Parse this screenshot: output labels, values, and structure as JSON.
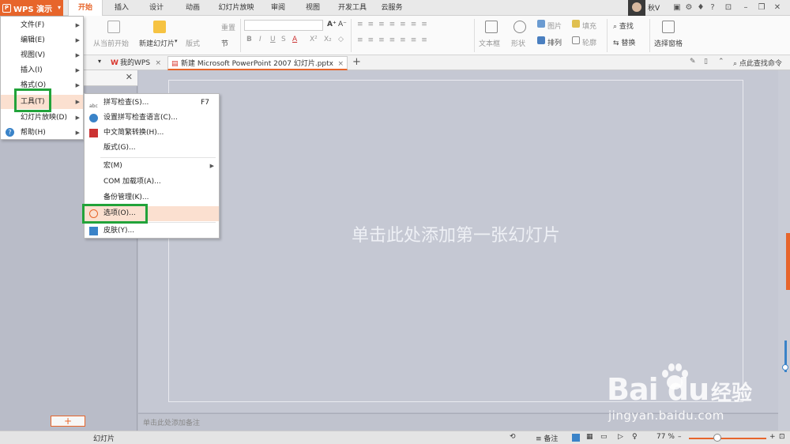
{
  "app": {
    "button_label": "WPS 演示",
    "user_name": "秋V"
  },
  "ribbon_tabs": [
    "开始",
    "插入",
    "设计",
    "动画",
    "幻灯片放映",
    "审阅",
    "视图",
    "开发工具",
    "云服务"
  ],
  "ribbon": {
    "from_current": "从当前开始",
    "new_slide": "新建幻灯片",
    "layout": "版式",
    "reset": "重置",
    "section": "节",
    "textbox": "文本框",
    "shape": "形状",
    "picture": "图片",
    "arrange": "排列",
    "fill": "填充",
    "outline": "轮廓",
    "find": "查找",
    "replace": "替换",
    "selection_pane": "选择窗格",
    "search_cmd": "点此查找命令"
  },
  "doc_tabs": [
    {
      "label": "我的WPS",
      "close": "×"
    },
    {
      "label": "新建 Microsoft PowerPoint 2007 幻灯片.pptx",
      "close": "×"
    }
  ],
  "doc_add": "+",
  "main_menu": {
    "items": [
      {
        "label": "文件(F)"
      },
      {
        "label": "编辑(E)"
      },
      {
        "label": "视图(V)"
      },
      {
        "label": "插入(I)"
      },
      {
        "label": "格式(O)"
      },
      {
        "label": "工具(T)"
      },
      {
        "label": "幻灯片放映(D)"
      },
      {
        "label": "帮助(H)"
      }
    ]
  },
  "tools_menu": {
    "items": [
      {
        "label": "拼写检查(S)...",
        "shortcut": "F7"
      },
      {
        "label": "设置拼写检查语言(C)..."
      },
      {
        "label": "中文简繁转换(H)..."
      },
      {
        "label": "版式(G)..."
      },
      {
        "label": "宏(M)"
      },
      {
        "label": "COM 加载项(A)..."
      },
      {
        "label": "备份管理(K)..."
      },
      {
        "label": "选项(O)..."
      },
      {
        "label": "皮肤(Y)..."
      }
    ]
  },
  "slide": {
    "prompt": "单击此处添加第一张幻灯片"
  },
  "notes": {
    "placeholder": "单击此处添加备注"
  },
  "status": {
    "slide_label": "幻灯片",
    "notes_btn": "备注",
    "zoom": "77 %"
  },
  "add_slide_symbol": "+",
  "watermark": {
    "logo": "Bai du",
    "cn": "经验",
    "url": "jingyan.baidu.com"
  },
  "colors": {
    "accent": "#e7652b",
    "highlight_box": "#22a33a",
    "menu_hover": "#fbe0d0"
  }
}
